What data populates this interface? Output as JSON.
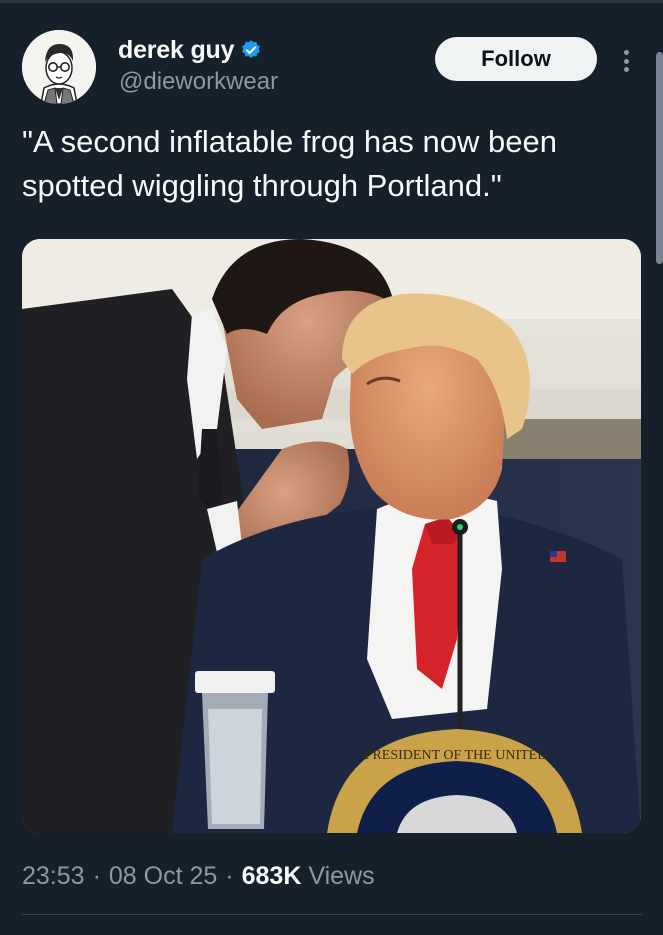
{
  "author": {
    "display_name": "derek guy",
    "handle": "@dieworkwear",
    "verified": true,
    "avatar_icon": "avatar-illustration-icon"
  },
  "actions": {
    "follow_label": "Follow",
    "more_icon": "more-options-icon"
  },
  "tweet": {
    "text": "\"A second inflatable frog has now been spotted wiggling through Portland.\""
  },
  "media": {
    "type": "photo",
    "seal_text": "PRESIDENT OF THE UNITED"
  },
  "meta": {
    "time": "23:53",
    "separator": "·",
    "date": "08 Oct 25",
    "views_count": "683K",
    "views_label": "Views"
  },
  "colors": {
    "background": "#15202b",
    "text": "#f7f9f9",
    "secondary_text": "#8b98a5",
    "verified_badge": "#1d9bf0",
    "follow_button_bg": "#eff3f4"
  }
}
